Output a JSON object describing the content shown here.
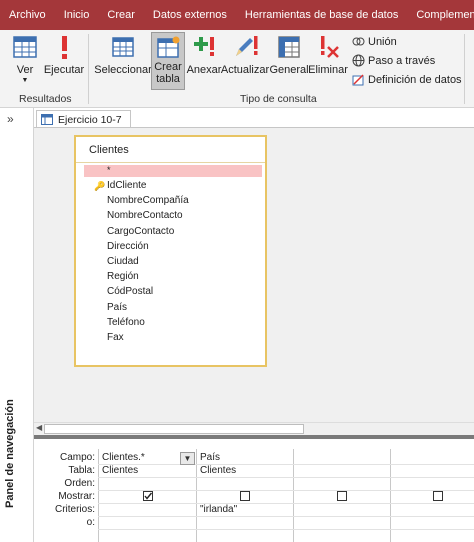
{
  "menu": [
    "Archivo",
    "Inicio",
    "Crear",
    "Datos externos",
    "Herramientas de base de datos",
    "Complementos"
  ],
  "ribbon": {
    "results_buttons": [
      "Ver",
      "Ejecutar"
    ],
    "results_group": "Resultados",
    "query_buttons": [
      {
        "top": "Seleccionar",
        "bottom": ""
      },
      {
        "top": "Crear",
        "bottom": "tabla"
      },
      {
        "top": "Anexar",
        "bottom": ""
      },
      {
        "top": "Actualizar",
        "bottom": ""
      },
      {
        "top": "General",
        "bottom": ""
      },
      {
        "top": "Eliminar",
        "bottom": ""
      }
    ],
    "small_buttons": [
      "Unión",
      "Paso a través",
      "Definición de datos"
    ],
    "query_group": "Tipo de consulta"
  },
  "nav_pane": {
    "chevron": "»",
    "label": "Panel de navegación"
  },
  "doc_tab": {
    "label": "Ejercicio 10-7"
  },
  "table": {
    "title": "Clientes",
    "star": "*",
    "fields": [
      "IdCliente",
      "NombreCompañía",
      "NombreContacto",
      "CargoContacto",
      "Dirección",
      "Ciudad",
      "Región",
      "CódPostal",
      "País",
      "Teléfono",
      "Fax"
    ]
  },
  "grid": {
    "row_labels": [
      "Campo:",
      "Tabla:",
      "Orden:",
      "Mostrar:",
      "Criterios:",
      "o:"
    ],
    "columns": [
      {
        "campo": "Clientes.*",
        "tabla": "Clientes",
        "mostrar": true,
        "criterios": ""
      },
      {
        "campo": "País",
        "tabla": "Clientes",
        "mostrar": false,
        "criterios": "\"irlanda\""
      },
      {
        "campo": "",
        "tabla": "",
        "mostrar": false,
        "criterios": ""
      },
      {
        "campo": "",
        "tabla": "",
        "mostrar": false,
        "criterios": ""
      }
    ]
  },
  "colors": {
    "menubar": "#a4373a",
    "highlight_border": "#e8c463",
    "star_row": "#f9c3c4"
  }
}
